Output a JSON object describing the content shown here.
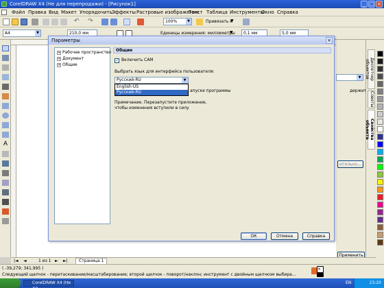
{
  "window": {
    "title": "CorelDRAW X4 (Не для перепродажи) - [Рисунок1]"
  },
  "menu": {
    "items": [
      "Файл",
      "Правка",
      "Вид",
      "Макет",
      "Упорядочить",
      "Эффекты",
      "Растровые изображения",
      "Текст",
      "Таблица",
      "Инструменты",
      "Окно",
      "Справка"
    ]
  },
  "toolbar": {
    "zoom_value": "100%",
    "snap_label": "Привязать к",
    "page_size": "A4",
    "width_value": "210,0 мм",
    "units_label": "Единицы измерения: миллиметры",
    "nudge_value": "0,1 мм",
    "dup_value": "5,0 мм"
  },
  "dialog": {
    "title": "Параметры",
    "close_glyph": "×",
    "tree": [
      {
        "label": "Рабочее пространство",
        "expander": "+"
      },
      {
        "label": "Документ",
        "expander": "+"
      },
      {
        "label": "Общие",
        "expander": "+"
      }
    ],
    "section_title": "Общие",
    "enable_cam_label": "Включить CAM",
    "enable_cam_checked": true,
    "language_label": "Выбрать язык для интерфейса пользователя:",
    "language_selected": "Русский-RU",
    "language_options": [
      "English-US",
      "Русский-RU"
    ],
    "language_highlighted": "Русский-RU",
    "startup_tail": "апуске программы",
    "note": "Примечание. Перезапустите приложение, чтобы изменения вступили в силу",
    "ok_label": "ОК",
    "cancel_label": "Отмена",
    "help_label": "Справка"
  },
  "docker": {
    "tabs": [
      "Диспетчер объектов",
      "Советы",
      "Свойства объекта"
    ],
    "visible_partial": "держит",
    "button_partial": "ительно...",
    "apply_label": "Применить"
  },
  "pagebar": {
    "page_counter": "1 из 1",
    "page_tab": "Страница 1"
  },
  "status": {
    "coords": "( -39,279; 341,995 )",
    "hint": "Следующий щелчок - перетаскивание/масштабирование; второй щелчок - поворот/наклон; инструмент с двойным щелчком выбира..."
  },
  "taskbar": {
    "start_label": "",
    "task_label": "CorelDRAW X4 (Не дл...",
    "lang": "EN",
    "time": "23:20"
  },
  "colors": {
    "palette": [
      "#000000",
      "#1a1a1a",
      "#333333",
      "#4d4d4d",
      "#666666",
      "#808080",
      "#999999",
      "#b3b3b3",
      "#cccccc",
      "#e6e6e6",
      "#ffffff",
      "#2e3192",
      "#0000ff",
      "#00aeef",
      "#00a651",
      "#00ff00",
      "#8dc63f",
      "#fff200",
      "#f7941d",
      "#ed1c24",
      "#ec008c",
      "#92278f",
      "#662d91",
      "#8b5e3c",
      "#c69c6d",
      "#603913"
    ]
  }
}
